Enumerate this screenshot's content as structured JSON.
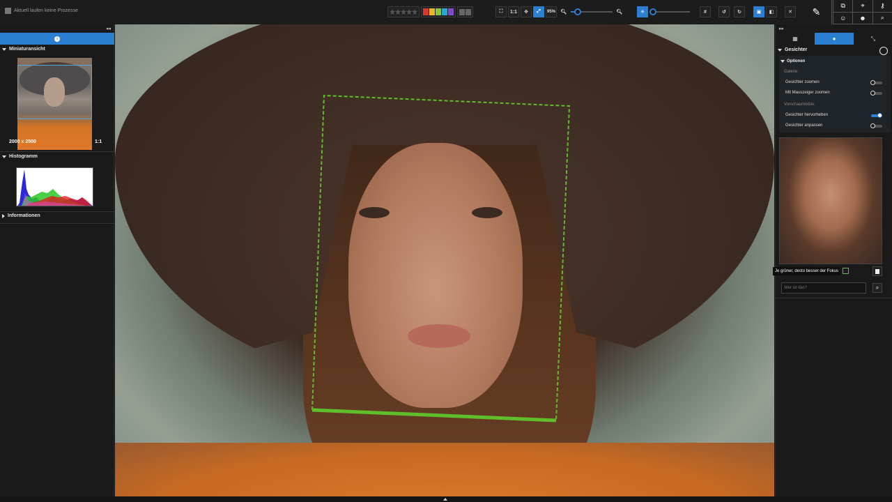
{
  "status": {
    "text": "Aktuell laufen keine Prozesse"
  },
  "toolbar": {
    "one_to_one": "1:1",
    "zoom_percent": "95%",
    "zoom_level": 0.1,
    "brightness_level": 0.0,
    "colors": [
      "#d93a2f",
      "#e8b72c",
      "#8cc63e",
      "#2aa7d8",
      "#7c4fc9"
    ]
  },
  "left_panel": {
    "thumbnail_title": "Miniaturansicht",
    "dimensions": "2000 x 2500",
    "ratio": "1:1",
    "histogram_title": "Histogramm",
    "info_title": "Informationen"
  },
  "right_panel": {
    "title": "Gesichter",
    "options_title": "Optionen",
    "gallery_label": "Galerie:",
    "zoom_faces": "Gesichter zoomen",
    "zoom_mouse": "Mit Mauszeiger zoomen",
    "preview_label": "Vorschaumodus:",
    "highlight_faces": "Gesichter hervorheben",
    "fit_faces": "Gesichter anpassen",
    "tooltip": "Je grüner, desto besser der Fokus",
    "who_placeholder": "Wer ist das?"
  }
}
